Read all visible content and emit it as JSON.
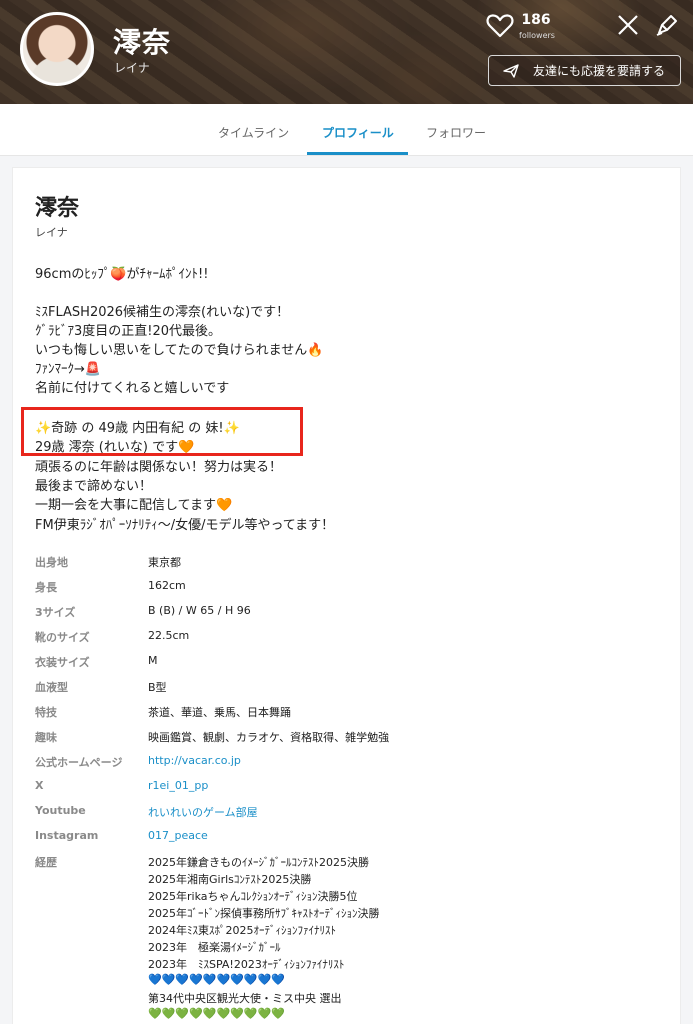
{
  "header": {
    "name": "澪奈",
    "kana": "レイナ",
    "followers_count": "186",
    "followers_label": "followers",
    "support_button": "友達にも応援を要請する"
  },
  "tabs": [
    {
      "label": "タイムライン"
    },
    {
      "label": "プロフィール"
    },
    {
      "label": "フォロワー"
    }
  ],
  "profile": {
    "name": "澪奈",
    "kana": "レイナ",
    "bio": [
      "96cmのﾋｯﾌﾟ🍑がﾁｬｰﾑﾎﾟｲﾝﾄ!!",
      "ﾐｽFLASH2026候補生の澪奈(れいな)です！",
      "ｸﾞﾗﾋﾞｱ3度目の正直!20代最後。",
      "いつも悔しい思いをしてたので負けられません🔥",
      "ﾌｧﾝﾏｰｸ→🚨",
      "名前に付けてくれると嬉しいです",
      "✨奇跡 の 49歳 内田有紀 の 妹!✨",
      "29歳 澪奈 (れいな) です🧡",
      "頑張るのに年齢は関係ない！努力は実る！",
      "最後まで諦めない！",
      "一期一会を大事に配信してます🧡",
      "FM伊東ﾗｼﾞｵﾊﾟｰｿﾅﾘﾃｨ〜/女優/モデル等やってます！"
    ]
  },
  "specs": [
    {
      "label": "出身地",
      "value": "東京都"
    },
    {
      "label": "身長",
      "value": "162cm"
    },
    {
      "label": "3サイズ",
      "value": "B (B) / W 65 / H 96"
    },
    {
      "label": "靴のサイズ",
      "value": "22.5cm"
    },
    {
      "label": "衣装サイズ",
      "value": "M"
    },
    {
      "label": "血液型",
      "value": "B型"
    },
    {
      "label": "特技",
      "value": "茶道、華道、乗馬、日本舞踊"
    },
    {
      "label": "趣味",
      "value": "映画鑑賞、観劇、カラオケ、資格取得、雑学勉強"
    },
    {
      "label": "公式ホームページ",
      "value": "http://vacar.co.jp"
    },
    {
      "label": "X",
      "value": "r1ei_01_pp"
    },
    {
      "label": "Youtube",
      "value": "れいれいのゲーム部屋"
    },
    {
      "label": "Instagram",
      "value": "017_peace"
    },
    {
      "label": "経歴",
      "value": ""
    }
  ],
  "career": [
    "2025年鎌倉きものｲﾒｰｼﾞｶﾞｰﾙｺﾝﾃｽﾄ2025決勝",
    "2025年湘南Girlsｺﾝﾃｽﾄ2025決勝",
    "2025年rikaちゃんｺﾚｸｼｮﾝｵｰﾃﾞｨｼｮﾝ決勝5位",
    "2025年ｺﾞｰﾄﾞﾝ探偵事務所ｻﾌﾞｷｬｽﾄｵｰﾃﾞｨｼｮﾝ決勝",
    "2024年ﾐｽ東ｽﾎﾟ2025ｵｰﾃﾞｨｼｮﾝﾌｧｲﾅﾘｽﾄ",
    "2023年　極楽湯ｲﾒｰｼﾞｶﾞｰﾙ",
    "2023年　ﾐｽSPA!2023ｵｰﾃﾞｨｼｮﾝﾌｧｲﾅﾘｽﾄ",
    "💙💙💙💙💙💙💙💙💙💙",
    "第34代中央区観光大使・ミス中央 選出",
    "💚💚💚💚💚💚💚💚💚💚"
  ],
  "colors": {
    "accent": "#1a8fc8",
    "highlight": "#e8261c"
  }
}
